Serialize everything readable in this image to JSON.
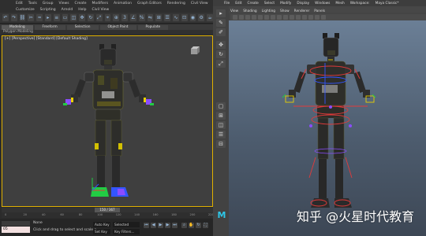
{
  "max": {
    "menu_row1": [
      "Edit",
      "Tools",
      "Group",
      "Views",
      "Create",
      "Modifiers",
      "Animation",
      "Graph Editors",
      "Rendering",
      "Civil View"
    ],
    "menu_row2": [
      "Customize",
      "Scripting",
      "Arnold",
      "Help",
      "Civil View"
    ],
    "ribbon_tabs": [
      "Modeling",
      "Freeform",
      "Selection",
      "Object Paint",
      "Populate"
    ],
    "ribbon_active": "Modeling",
    "poly_label": "Polygon Modeling",
    "viewport_label": "[+] [Perspective] [Standard] [Default Shading]",
    "time_slider": "150 / 367",
    "ruler_ticks": [
      "0",
      "20",
      "40",
      "60",
      "80",
      "100",
      "120",
      "140",
      "160",
      "180",
      "200",
      "220"
    ],
    "status": {
      "script_text": "05",
      "selection": "None",
      "hint": "Click and drag to select and scale o",
      "autokey": "Auto Key",
      "setkey": "Set Key",
      "selected": "Selected",
      "key_filters": "Key Filters..."
    }
  },
  "maya": {
    "menus": [
      "File",
      "Edit",
      "Create",
      "Select",
      "Modify",
      "Display",
      "Windows",
      "Mesh",
      "Workspace:",
      "Maya Classic*"
    ],
    "viewport_tabs": [
      "View",
      "Shading",
      "Lighting",
      "Show",
      "Renderer",
      "Panels"
    ],
    "logo": "M"
  },
  "watermark": "知乎 @火星时代教育",
  "colors": {
    "max_viewport_border": "#e0b000",
    "maya_viewport_top": "#6b7f96",
    "maya_viewport_bottom": "#3d4755",
    "gizmo_green": "#22cc44",
    "gizmo_blue": "#3355ff",
    "rig_red": "#e23a3a",
    "rig_purple": "#8b4cff",
    "rig_yellow": "#e8d000"
  }
}
